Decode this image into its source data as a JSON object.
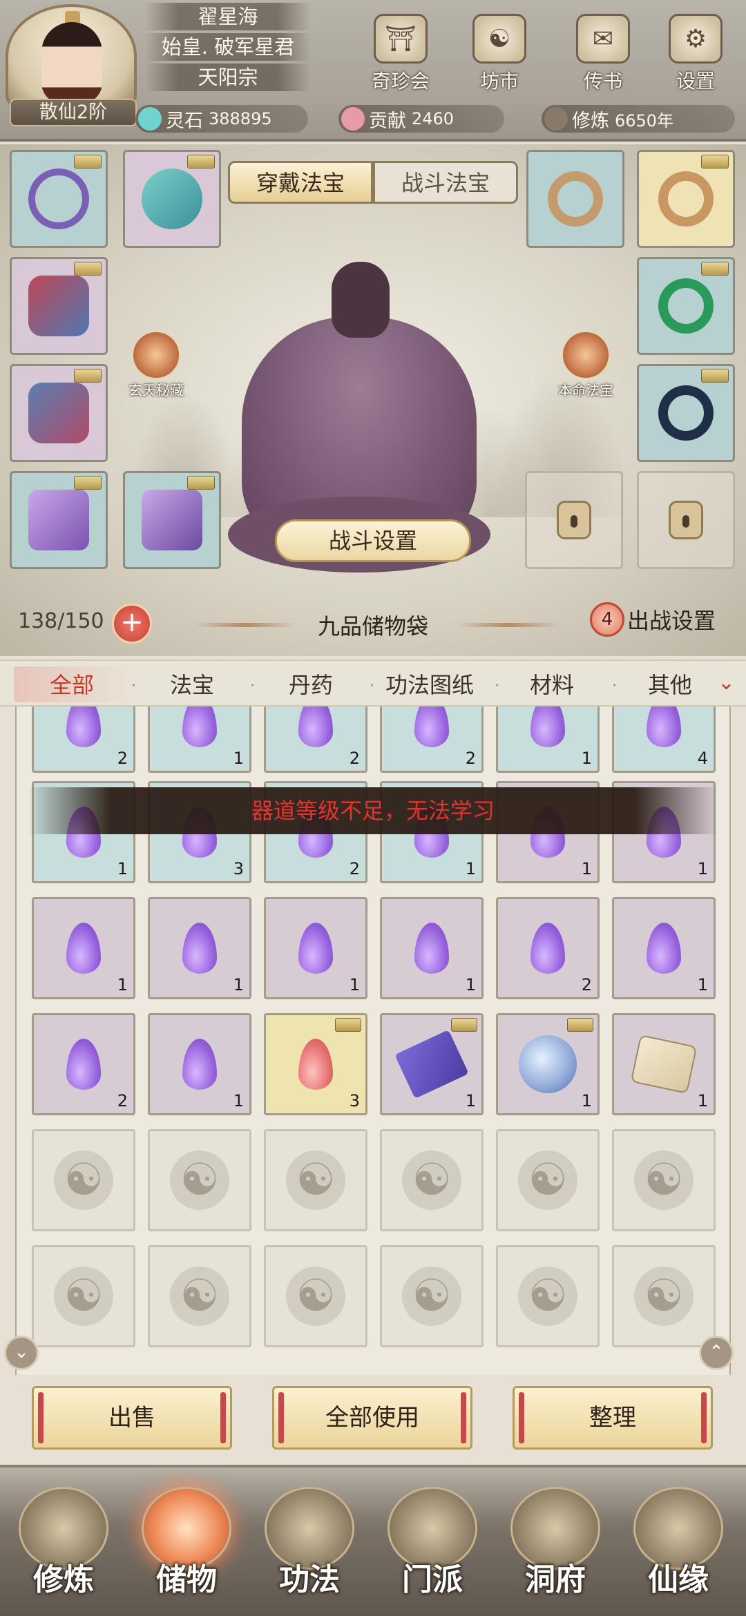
{
  "header": {
    "player_name": "翟星海",
    "player_title": "始皇. 破军星君",
    "sect": "天阳宗",
    "rank": "散仙2阶",
    "buttons": [
      {
        "label": "奇珍会",
        "icon": "treasure-pavilion-icon"
      },
      {
        "label": "坊市",
        "icon": "market-icon"
      },
      {
        "label": "传书",
        "icon": "letter-icon"
      },
      {
        "label": "设置",
        "icon": "gear-icon"
      }
    ],
    "resources": {
      "spirit_stone_label": "灵石",
      "spirit_stone_value": "388895",
      "contribution_label": "贡献",
      "contribution_value": "2460",
      "cultivation_label": "修炼",
      "cultivation_value": "6650年"
    }
  },
  "equip": {
    "tabs": [
      "穿戴法宝",
      "战斗法宝"
    ],
    "left_orb_label": "玄天秘藏",
    "right_orb_label": "本命法宝",
    "battle_settings": "战斗设置"
  },
  "bag": {
    "capacity": "138/150",
    "name": "九品储物袋",
    "deploy_count": "4",
    "deploy_label": "出战设置"
  },
  "categories": [
    "全部",
    "法宝",
    "丹药",
    "功法图纸",
    "材料",
    "其他"
  ],
  "toast": "器道等级不足，无法学习",
  "grid": {
    "row1": [
      "2",
      "1",
      "2",
      "2",
      "1",
      "4"
    ],
    "row2": [
      "1",
      "3",
      "2",
      "1",
      "1",
      "1"
    ],
    "row3": [
      "1",
      "1",
      "1",
      "1",
      "2",
      "1"
    ],
    "row4": [
      "2",
      "1",
      "3",
      "1",
      "1",
      "1"
    ]
  },
  "actions": [
    "出售",
    "全部使用",
    "整理"
  ],
  "bottom_nav": [
    "修炼",
    "储物",
    "功法",
    "门派",
    "洞府",
    "仙缘"
  ],
  "colors": {
    "toast_text": "#e5322b",
    "active_tab": "#c23a2a",
    "drop_purple": "#9b67e0"
  }
}
